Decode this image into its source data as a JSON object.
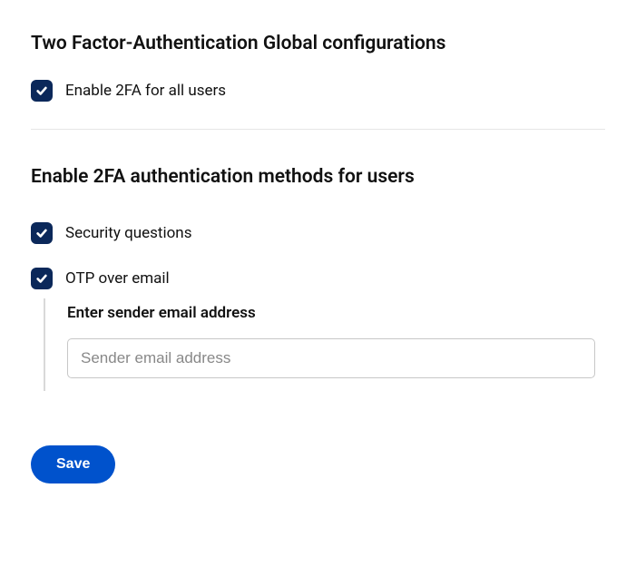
{
  "global": {
    "title": "Two Factor-Authentication Global configurations",
    "enable_all_label": "Enable 2FA for all users",
    "enable_all_checked": true
  },
  "methods": {
    "title": "Enable 2FA authentication methods for users",
    "security_questions": {
      "label": "Security questions",
      "checked": true
    },
    "otp_email": {
      "label": "OTP over email",
      "checked": true,
      "sender_label": "Enter sender email address",
      "sender_placeholder": "Sender email address",
      "sender_value": ""
    }
  },
  "actions": {
    "save_label": "Save"
  }
}
